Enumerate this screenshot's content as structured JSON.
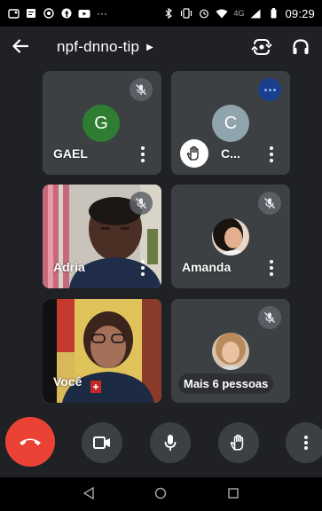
{
  "status_bar": {
    "time": "09:29",
    "network": "4G",
    "left_icons": [
      "notification-icon",
      "message-icon",
      "whatsapp-icon",
      "facebook-icon",
      "youtube-icon",
      "more-icon"
    ],
    "right_icons": [
      "bluetooth-icon",
      "vibrate-icon",
      "alarm-icon",
      "wifi-icon",
      "signal-icon",
      "battery-icon"
    ]
  },
  "app_bar": {
    "title": "npf-dnno-tip"
  },
  "tiles": [
    {
      "name": "GAEL",
      "avatar_letter": "G",
      "avatar_color": "#2e7d32",
      "muted": true
    },
    {
      "name": "C...",
      "avatar_letter": "C",
      "avatar_color": "#90a4ae",
      "hand_raised": true
    },
    {
      "name": "Adria",
      "muted": true,
      "video": true
    },
    {
      "name": "Amanda",
      "muted": true
    },
    {
      "name": "Você",
      "video": true
    },
    {
      "more_label": "Mais 6 pessoas",
      "muted": true
    }
  ],
  "colors": {
    "hangup": "#ea4335",
    "tile_bg": "#3c4043",
    "background": "#202124"
  }
}
